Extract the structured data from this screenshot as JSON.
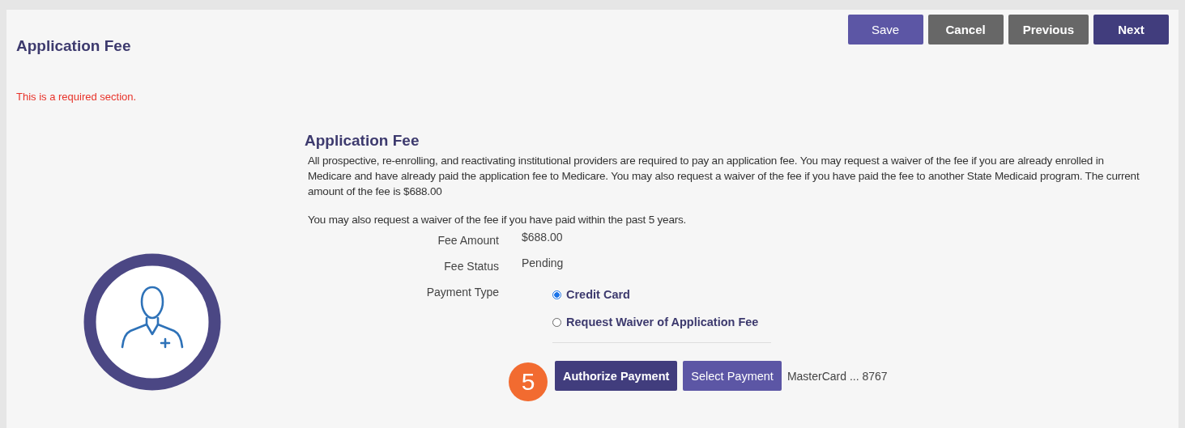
{
  "page_title": "Application Fee",
  "actions": [
    {
      "label": "Save",
      "kind": "light"
    },
    {
      "label": "Cancel",
      "kind": "grey"
    },
    {
      "label": "Previous",
      "kind": "grey"
    },
    {
      "label": "Next",
      "kind": "dark"
    }
  ],
  "required_note": "This is a required section.",
  "section": {
    "title": "Application Fee",
    "description": "All prospective, re-enrolling, and reactivating institutional providers are required to pay an application fee. You may request a waiver of the fee if you are already enrolled in Medicare and have already paid the application fee to Medicare. You may also request a waiver of the fee if you have paid the fee to another State Medicaid program. The current amount of the fee is $688.00",
    "note": "You may also request a waiver of the fee if you have paid within the past 5 years.",
    "fields": [
      {
        "label": "Fee Amount",
        "value": "$688.00"
      },
      {
        "label": "Fee Status",
        "value": "Pending"
      }
    ],
    "payment_type": {
      "label": "Payment Type",
      "options": [
        {
          "label": "Credit Card",
          "selected": true
        },
        {
          "label": "Request Waiver of Application Fee",
          "selected": false
        }
      ]
    },
    "step_badge": "5",
    "buttons": [
      {
        "label": "Authorize Payment",
        "kind": "dark"
      },
      {
        "label": "Select Payment",
        "kind": "light"
      }
    ],
    "card": "MasterCard ... 8767"
  }
}
